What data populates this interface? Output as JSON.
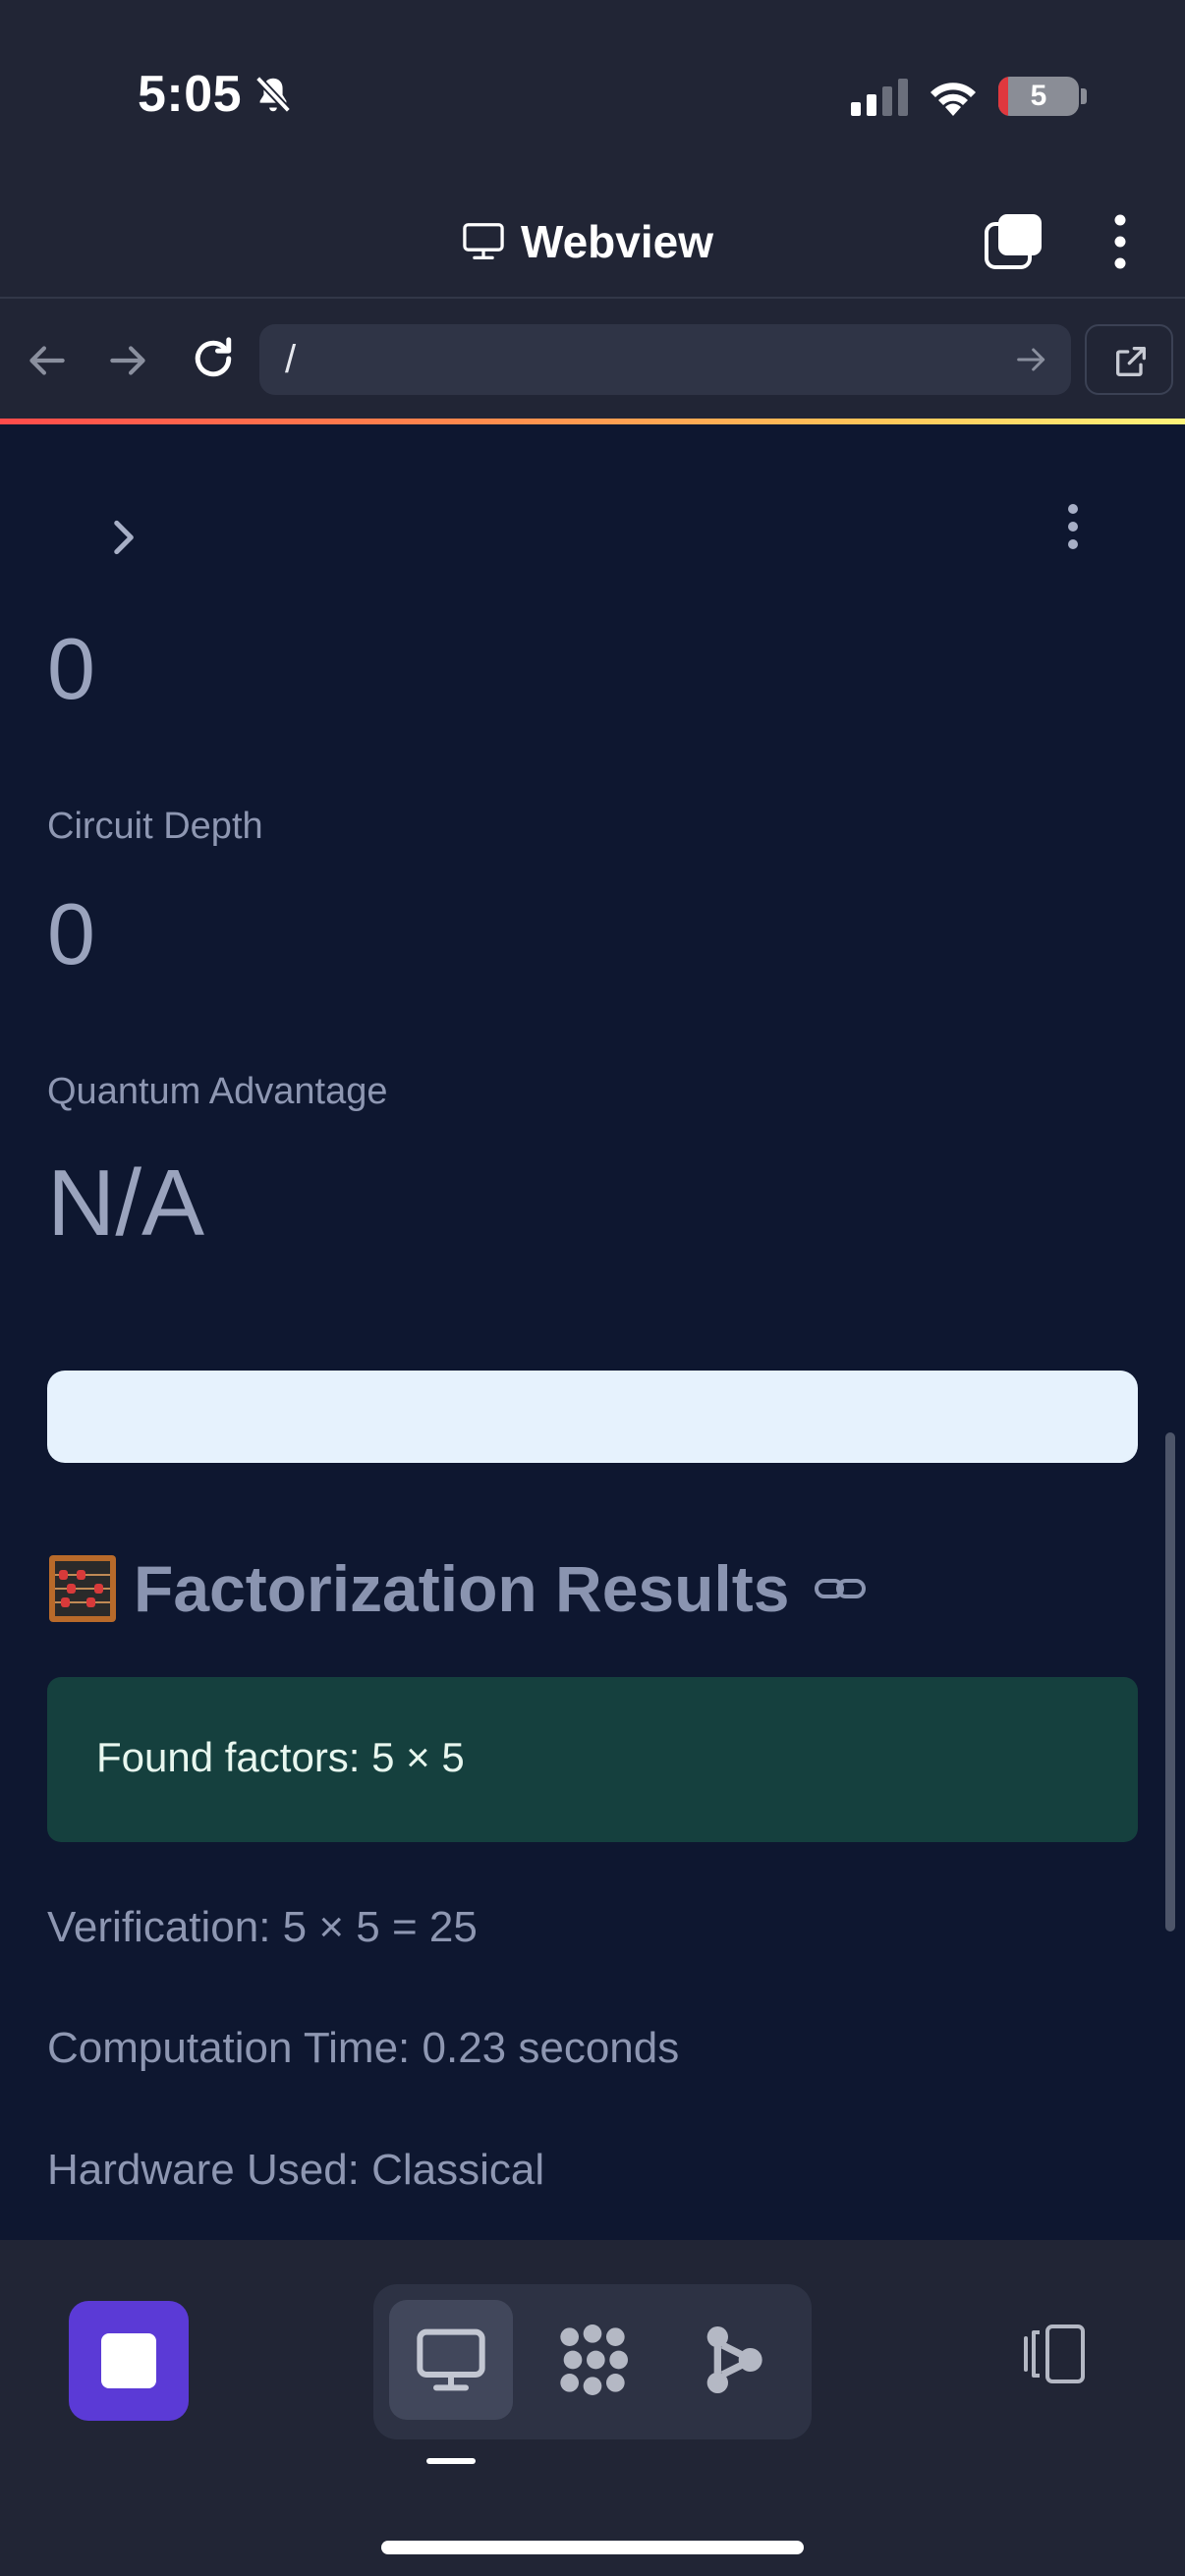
{
  "status_bar": {
    "time": "5:05",
    "battery_level": "5",
    "icons": [
      "bell-slash-icon",
      "cellular-signal-icon",
      "wifi-icon",
      "battery-icon"
    ]
  },
  "webview": {
    "title": "Webview",
    "icons": [
      "monitor-icon",
      "tabs-icon",
      "more-vertical-icon"
    ]
  },
  "url_bar": {
    "url": "/",
    "icons": [
      "back-arrow-icon",
      "forward-arrow-icon",
      "reload-icon",
      "go-arrow-icon",
      "open-external-icon"
    ]
  },
  "page": {
    "metrics": [
      {
        "label": "",
        "value": "0"
      },
      {
        "label": "Circuit Depth",
        "value": "0"
      },
      {
        "label": "Quantum Advantage",
        "value": "N/A"
      }
    ],
    "section_title": "Factorization Results",
    "section_icon": "abacus-icon",
    "success_message": "Found factors: 5 × 5",
    "verification": "Verification: 5 × 5 = 25",
    "computation_time": "Computation Time: 0.23 seconds",
    "hardware": "Hardware Used: Classical"
  },
  "toolbar": {
    "items": [
      "stop-icon",
      "desktop-icon",
      "dots-grid-icon",
      "branch-icon",
      "panel-icon"
    ],
    "active_item": "desktop-icon",
    "accent_color": "#5b3ad6"
  },
  "colors": {
    "page_bg": "#0e1730",
    "chrome_bg": "#212535",
    "success_bg": "#15403e",
    "progress_bg": "#e6f2fd"
  }
}
